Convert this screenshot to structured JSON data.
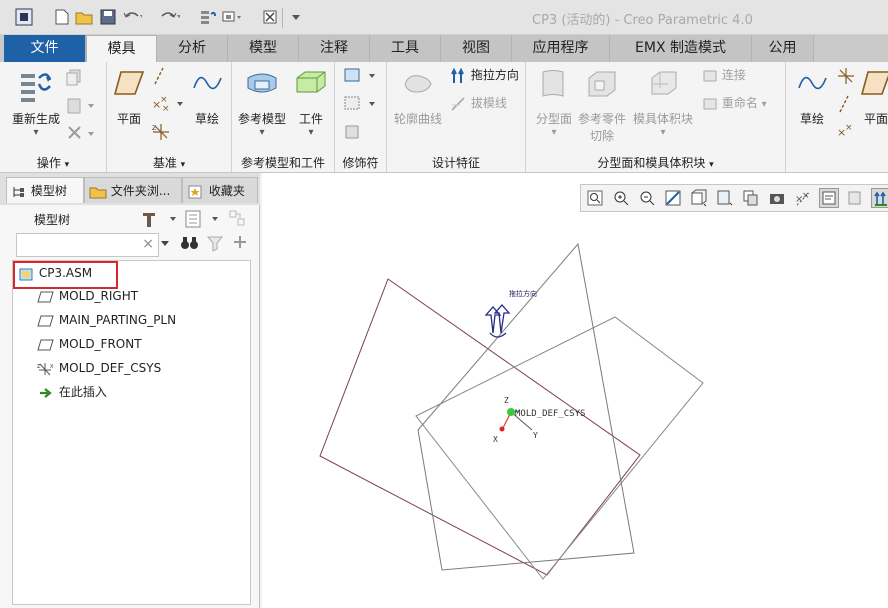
{
  "window": {
    "title": "CP3 (活动的) - Creo Parametric 4.0"
  },
  "quick_access": [
    "app-icon",
    "new-icon",
    "open-icon",
    "save-icon",
    "undo-icon",
    "redo-icon",
    "regenerate-icon",
    "windows-icon",
    "close-icon",
    "more-icon"
  ],
  "tabs": [
    {
      "label": "文件"
    },
    {
      "label": "模具"
    },
    {
      "label": "分析"
    },
    {
      "label": "模型"
    },
    {
      "label": "注释"
    },
    {
      "label": "工具"
    },
    {
      "label": "视图"
    },
    {
      "label": "应用程序"
    },
    {
      "label": "EMX 制造模式"
    },
    {
      "label": "公用"
    }
  ],
  "ribbon": {
    "groups": [
      {
        "label": "操作",
        "dropdown": "▾"
      },
      {
        "label": "基准",
        "dropdown": "▾"
      },
      {
        "label": "参考模型和工件"
      },
      {
        "label": "修饰符"
      },
      {
        "label": "设计特征"
      },
      {
        "label": "分型面和模具体积块",
        "dropdown": "▾"
      }
    ],
    "buttons": {
      "regenerate": "重新生成",
      "plane": "平面",
      "sketch": "草绘",
      "reference_model": "参考模型",
      "workpiece": "工件",
      "silhouette": "轮廓曲线",
      "drag_direction": "拖拉方向",
      "draft_line": "拔模线",
      "parting_surface": "分型面",
      "ref_part_cutout": [
        "参考零件",
        "切除"
      ],
      "mold_volume": "模具体积块",
      "connect": "连接",
      "rename": "重命名",
      "sketch2": "草绘",
      "plane2": "平面"
    }
  },
  "panel": {
    "tabs": [
      {
        "label": "模型树",
        "icon": "tree-icon"
      },
      {
        "label": "文件夹浏...",
        "icon": "folder-icon"
      },
      {
        "label": "收藏夹",
        "icon": "favorites-icon"
      }
    ],
    "title": "模型树",
    "search": {
      "value": "",
      "clear": "×"
    },
    "tree": {
      "root": "CP3.ASM",
      "items": [
        {
          "label": "MOLD_RIGHT",
          "icon": "datum-plane-icon"
        },
        {
          "label": "MAIN_PARTING_PLN",
          "icon": "datum-plane-icon"
        },
        {
          "label": "MOLD_FRONT",
          "icon": "datum-plane-icon"
        },
        {
          "label": "MOLD_DEF_CSYS",
          "icon": "csys-icon"
        },
        {
          "label": "在此插入",
          "icon": "insert-here-icon"
        }
      ]
    }
  },
  "graphics": {
    "csys_label": "MOLD_DEF_CSYS",
    "drag_direction_label": "拖拉方向",
    "axis_labels": {
      "z": "Z",
      "y": "Y",
      "x": "X"
    },
    "plane_color": "#7a3d5a",
    "highlight_color": "#d9262b",
    "file_tab_color": "#1f61a6"
  }
}
